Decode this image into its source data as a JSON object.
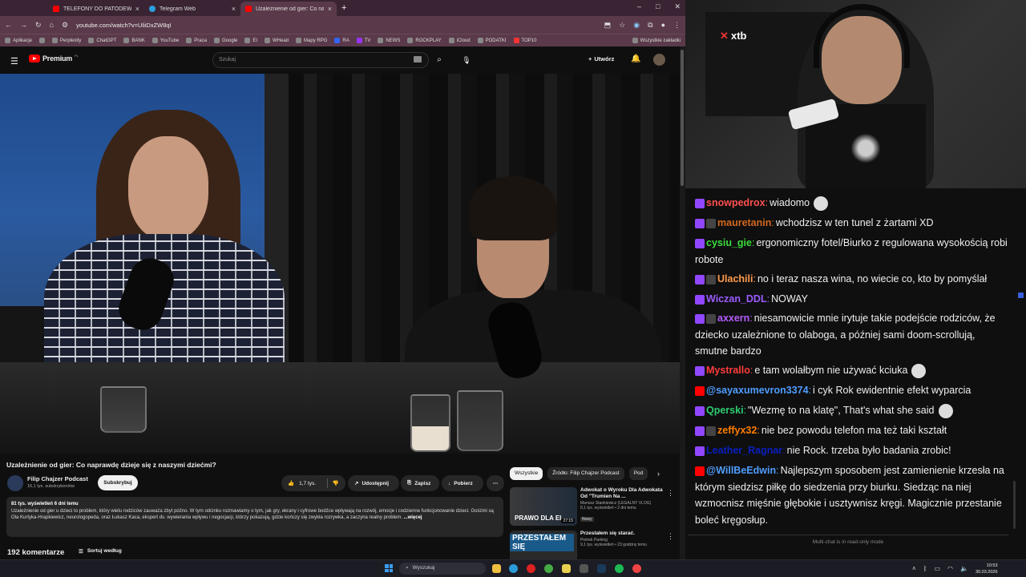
{
  "browser": {
    "tabs": [
      {
        "title": "TELEFONY DO PATODEWELOP...",
        "icon": "youtube-icon"
      },
      {
        "title": "Telegram Web",
        "icon": "telegram-icon"
      },
      {
        "title": "Uzależnienie od gier: Co naprawd...",
        "icon": "youtube-icon",
        "active": true
      }
    ],
    "url": "youtube.com/watch?v=UliiDxZW8qI",
    "bookmarks": [
      "Aplikacje",
      "Perplexity",
      "ChatGPT",
      "BANK",
      "YouTube",
      "Praca",
      "Google",
      "EI",
      "WHead",
      "Mapy RPG",
      "RA",
      "TV",
      "NEWS",
      "ROCKPLAY",
      "iCloud",
      "PODATKI",
      "TOP10"
    ],
    "bookmarks_all": "Wszystkie zakładki"
  },
  "youtube": {
    "logo": "Premium",
    "logo_cc": "PL",
    "search_placeholder": "Szukaj",
    "create_label": "Utwórz",
    "video_title": "Uzależnienie od gier: Co naprawdę dzieje się z naszymi dziećmi?",
    "channel_name": "Filip Chajzer Podcast",
    "channel_subs": "16,1 tys. subskrybentów",
    "subscribe_label": "Subskrybuj",
    "likes": "1,7 tys.",
    "share_label": "Udostępnij",
    "save_label": "Zapisz",
    "download_label": "Pobierz",
    "views_date": "81 tys. wyświetleń  6 dni temu",
    "description": "Uzależnienie od gier u dzieci to problem, który wielu rodziców zauważa zbyt późno. W tym odcinku rozmawiamy o tym, jak gry, ekrany i cyfrowe bodźce wpływają na rozwój, emocje i codzienne funkcjonowanie dzieci. Gośćmi są Ola Kurtyka-Hrapkiewicz, neurologopeda, oraz Łukasz Kaca, ekspert ds. wywierania wpływu i negocjacji, którzy pokazują, gdzie kończy się zwykła rozrywka, a zaczyna realny problem.",
    "more_label": "...więcej",
    "comments_count": "192 komentarze",
    "sort_label": "Sortuj według",
    "chips": [
      "Wszystkie",
      "Źródło: Filip Chajzer Podcast",
      "Pod"
    ],
    "recommendations": [
      {
        "title": "Adwokat o Wyroku Dla Adwokata Od \"Trumien Na ...",
        "channel": "Mariusz Stankiewicz (LEGALNY VLOG)",
        "meta": "8,1 tys. wyświetleń • 2 dni temu",
        "badge": "Nowy",
        "duration": "27:15",
        "thumb_text": "PRAWO DLA EI"
      },
      {
        "title": "Przestałem się starać.",
        "channel": "Piotrek Parking",
        "meta": "9,1 tys. wyświetleń • 23 godziny temu",
        "duration": "",
        "thumb_text": "PRZESTAŁEM SIĘ"
      }
    ]
  },
  "webcam": {
    "sign": "xtb"
  },
  "chat": {
    "messages": [
      {
        "platform": "twitch",
        "user": "snowpedrox",
        "color": "#ff4f4f",
        "text": "wiadomo",
        "emote": true
      },
      {
        "platform": "twitch",
        "user": "mauretanin",
        "color": "#d2691e",
        "text": "wchodzisz w ten tunel z żartami XD"
      },
      {
        "platform": "twitch",
        "user": "cysiu_gie",
        "color": "#3cdc3c",
        "text": "ergonomiczny fotel/Biurko z regulowana wysokością robi robote"
      },
      {
        "platform": "twitch",
        "user": "Ulachili",
        "color": "#ff9a4f",
        "text": "no i teraz nasza wina, no wiecie co, kto by pomyślał"
      },
      {
        "platform": "twitch",
        "user": "Wiczan_DDL",
        "color": "#9b5cff",
        "text": "NOWAY"
      },
      {
        "platform": "twitch",
        "user": "axxern",
        "color": "#b45cff",
        "text": "niesamowicie mnie irytuje takie podejście rodziców, że dziecko uzależnione to olaboga, a później sami doom-scrollują, smutne bardzo"
      },
      {
        "platform": "twitch",
        "user": "Mystrallo",
        "color": "#ff3c3c",
        "text": "e tam wolałbym nie używać kciuka",
        "emote": true
      },
      {
        "platform": "youtube",
        "user": "@sayaxumevron3374",
        "color": "#4f9dff",
        "text": "i cyk Rok ewidentnie efekt wyparcia"
      },
      {
        "platform": "twitch",
        "user": "Qperski",
        "color": "#2ecc71",
        "text": "\"Wezmę to na klatę\", That's what she said",
        "emote": true
      },
      {
        "platform": "twitch",
        "user": "zeffyx32",
        "color": "#ff7f00",
        "text": "nie bez powodu telefon ma też taki kształt"
      },
      {
        "platform": "twitch",
        "user": "Leather_Ragnar",
        "color": "#0a1fbf",
        "text": "nie Rock. trzeba było badania zrobic!"
      },
      {
        "platform": "youtube",
        "user": "@WillBeEdwin",
        "color": "#4f9dff",
        "text": "Najlepszym sposobem jest zamienienie krzesła na którym siedzisz piłkę do siedzenia przy biurku. Siedząc na niej wzmocnisz mięśnie głębokie i usztywnisz kręgi. Magicznie przestanie boleć kręgosłup."
      }
    ],
    "readonly_notice": "Multi-chat is in read-only mode"
  },
  "taskbar": {
    "search_label": "Wyszukaj",
    "time": "10:53",
    "date": "30.03.2026"
  }
}
